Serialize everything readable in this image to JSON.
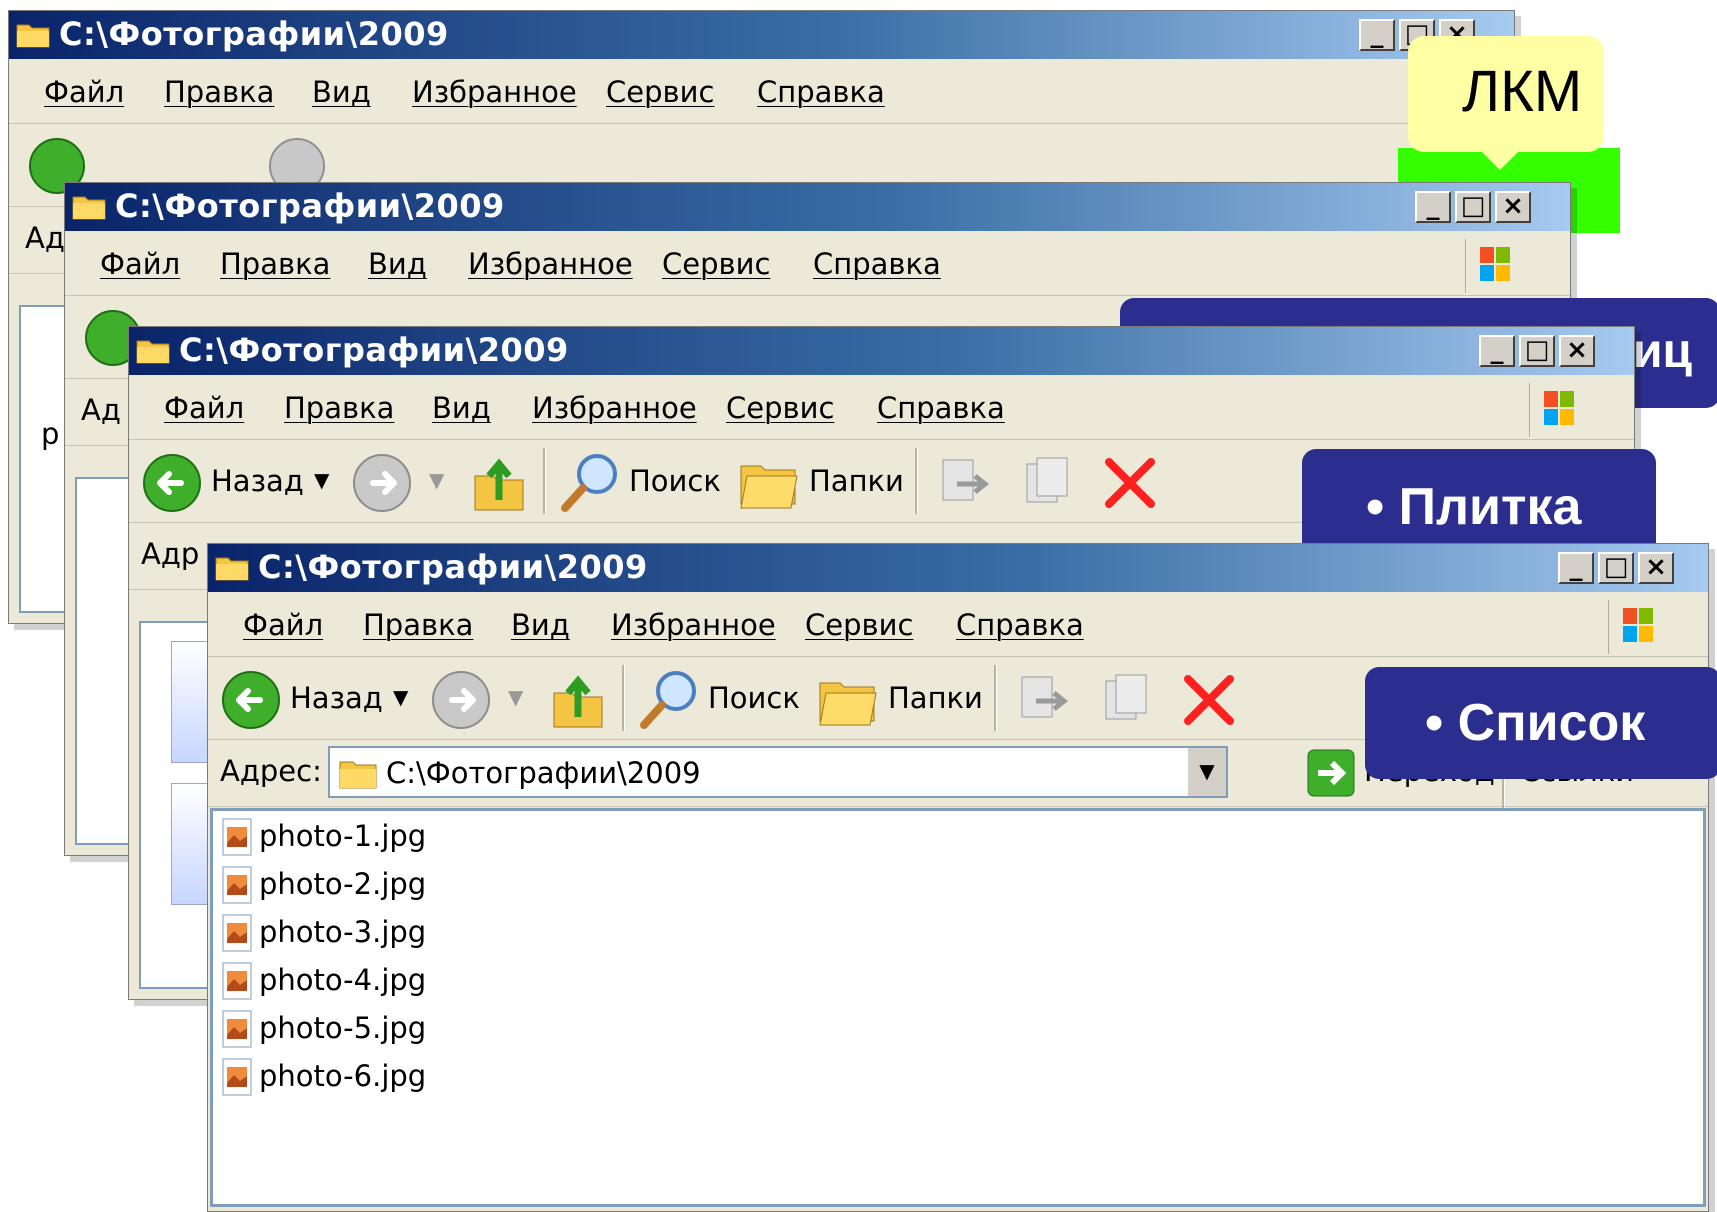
{
  "window": {
    "title": "C:\\Фотографии\\2009",
    "title_icon": "folder-icon",
    "caption_buttons": [
      "minimize",
      "maximize",
      "close"
    ]
  },
  "menu": [
    "Файл",
    "Правка",
    "Вид",
    "Избранное",
    "Сервис",
    "Справка"
  ],
  "toolbar": {
    "back": "Назад",
    "search": "Поиск",
    "folders": "Папки"
  },
  "address": {
    "label": "Адрес:",
    "value": "C:\\Фотографии\\2009",
    "go": "Переход",
    "links": "Ссылки",
    "links_more": "»",
    "partial_label": "Адр",
    "partial_label_short": "Ад"
  },
  "files": [
    "photo-1.jpg",
    "photo-2.jpg",
    "photo-3.jpg",
    "photo-4.jpg",
    "photo-5.jpg",
    "photo-6.jpg"
  ],
  "callouts": {
    "lkm": "ЛКМ",
    "partial": "иц",
    "tiles": "• Плитка",
    "list": "• Список"
  },
  "partial_text": "р",
  "colors": {
    "callout_bg": "#2b2e8f",
    "lkm_bg": "#ffffa3",
    "highlight_green": "#33ff00",
    "delete_red": "#ff2020"
  }
}
